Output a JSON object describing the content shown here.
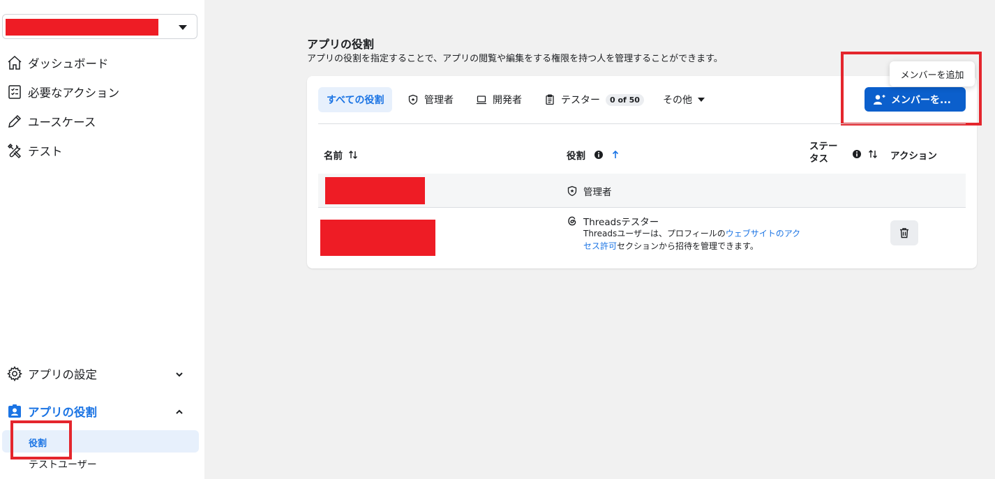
{
  "sidebar": {
    "nav": [
      {
        "label": "ダッシュボード",
        "icon": "home-icon"
      },
      {
        "label": "必要なアクション",
        "icon": "checklist-icon"
      },
      {
        "label": "ユースケース",
        "icon": "pencil-icon"
      },
      {
        "label": "テスト",
        "icon": "tools-icon"
      }
    ],
    "settings_label": "アプリの設定",
    "roles_label": "アプリの役割",
    "sub_active": "役割",
    "sub_test_users": "テストユーザー"
  },
  "page": {
    "title": "アプリの役割",
    "subtitle": "アプリの役割を指定することで、アプリの閲覧や編集をする権限を持つ人を管理することができます。"
  },
  "tabs": {
    "all": "すべての役割",
    "admin": "管理者",
    "developer": "開発者",
    "tester": "テスター",
    "tester_badge": "0 of 50",
    "other": "その他"
  },
  "add_button": "メンバーを...",
  "tooltip": "メンバーを追加",
  "table": {
    "headers": {
      "name": "名前",
      "role": "役割",
      "status_line1": "ステー",
      "status_line2": "タス",
      "action": "アクション"
    },
    "rows": [
      {
        "role": "管理者"
      },
      {
        "role": "Threadsテスター",
        "desc_prefix": "Threadsユーザーは、プロフィールの",
        "desc_link": "ウェブサイトのアクセス許可",
        "desc_suffix": "セクションから招待を管理できます。"
      }
    ]
  },
  "colors": {
    "accent": "#1b74e4",
    "button": "#0b5fcc",
    "highlight_box": "#e4262d",
    "redaction": "#ee1c25"
  }
}
